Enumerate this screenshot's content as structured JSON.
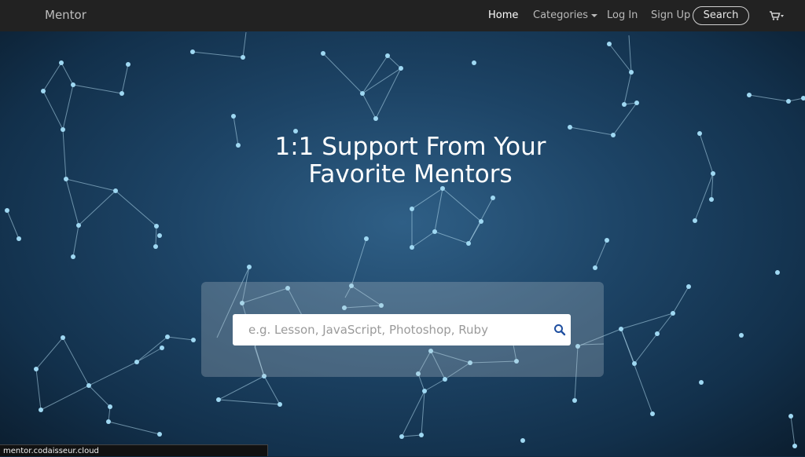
{
  "navbar": {
    "brand": "Mentor",
    "items": [
      {
        "label": "Home",
        "active": true
      },
      {
        "label": "Categories",
        "dropdown": true
      },
      {
        "label": "Log In"
      },
      {
        "label": "Sign Up"
      }
    ],
    "search_label": "Search",
    "cart_icon": "cart-icon"
  },
  "hero": {
    "title_line1": "1:1 Support From Your",
    "title_line2": "Favorite Mentors",
    "search": {
      "placeholder": "e.g. Lesson, JavaScript, Photoshop, Ruby",
      "value": "",
      "icon": "search-icon"
    }
  },
  "status_bar": {
    "url": "mentor.codaisseur.cloud"
  },
  "colors": {
    "navbar_bg": "#222222",
    "hero_bg": "#1d4466",
    "node": "#9fd8f2",
    "search_icon": "#1f4fa0"
  }
}
